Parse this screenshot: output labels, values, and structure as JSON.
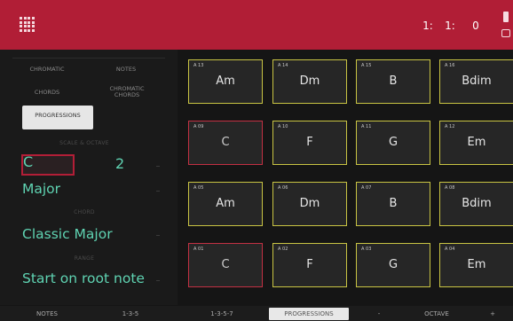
{
  "header": {
    "menu_icon": "grid-menu-icon",
    "accent_color": "#b11e36",
    "columns": [
      {
        "label": "",
        "value": "1:"
      },
      {
        "label": "",
        "value": "1:"
      },
      {
        "label": "",
        "value": "0"
      }
    ],
    "battery_icon": "battery-icon",
    "power_icon": "power-plug-icon"
  },
  "modes": {
    "chromatic": "CHROMATIC",
    "notes": "NOTES",
    "chords": "CHORDS",
    "chromatic_chords_line1": "CHROMATIC",
    "chromatic_chords_line2": "CHORDS",
    "progressions": "PROGRESSIONS"
  },
  "settings": {
    "scale_octave_label": "SCALE & OCTAVE",
    "root": "C",
    "octave": "2",
    "scale": "Major",
    "chord_label": "CHORD",
    "chord": "Classic Major",
    "range_label": "RANGE",
    "range": "Start on root note",
    "value_color": "#5fd3b2"
  },
  "pads": [
    {
      "num": "A 13",
      "chord": "Am",
      "color": "yellow"
    },
    {
      "num": "A 14",
      "chord": "Dm",
      "color": "yellow"
    },
    {
      "num": "A 15",
      "chord": "B",
      "color": "yellow"
    },
    {
      "num": "A 16",
      "chord": "Bdim",
      "color": "yellow"
    },
    {
      "num": "A 09",
      "chord": "C",
      "color": "red"
    },
    {
      "num": "A 10",
      "chord": "F",
      "color": "yellow"
    },
    {
      "num": "A 11",
      "chord": "G",
      "color": "yellow"
    },
    {
      "num": "A 12",
      "chord": "Em",
      "color": "yellow"
    },
    {
      "num": "A 05",
      "chord": "Am",
      "color": "yellow"
    },
    {
      "num": "A 06",
      "chord": "Dm",
      "color": "yellow"
    },
    {
      "num": "A 07",
      "chord": "B",
      "color": "yellow"
    },
    {
      "num": "A 08",
      "chord": "Bdim",
      "color": "yellow"
    },
    {
      "num": "A 01",
      "chord": "C",
      "color": "red"
    },
    {
      "num": "A 02",
      "chord": "F",
      "color": "yellow"
    },
    {
      "num": "A 03",
      "chord": "G",
      "color": "yellow"
    },
    {
      "num": "A 04",
      "chord": "Em",
      "color": "yellow"
    }
  ],
  "footer": {
    "notes": "NOTES",
    "triad": "1-3-5",
    "seventh": "1-3-5-7",
    "progressions": "PROGRESSIONS",
    "minus": "-",
    "octave": "OCTAVE",
    "plus": "+"
  }
}
